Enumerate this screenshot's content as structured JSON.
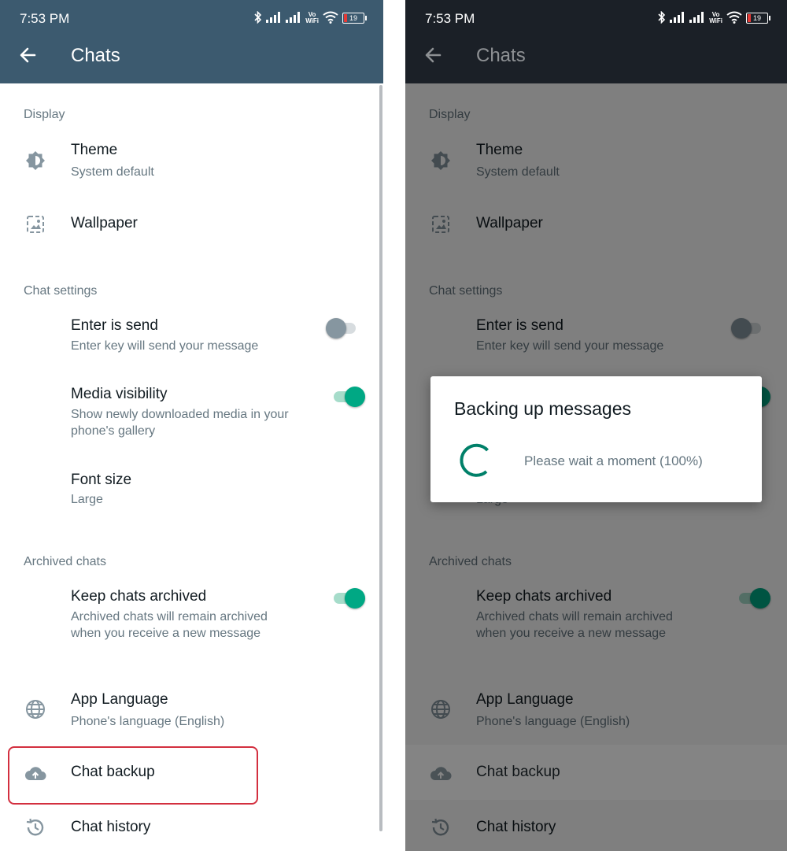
{
  "status_bar": {
    "time": "7:53 PM",
    "battery_level": "19",
    "vowifi_top": "Vo",
    "vowifi_bottom": "WiFi"
  },
  "appbar": {
    "title": "Chats"
  },
  "sections": {
    "display": "Display",
    "chat_settings": "Chat settings",
    "archived_chats": "Archived chats"
  },
  "items": {
    "theme": {
      "title": "Theme",
      "subtitle": "System default"
    },
    "wallpaper": {
      "title": "Wallpaper"
    },
    "enter_is_send": {
      "title": "Enter is send",
      "subtitle": "Enter key will send your message",
      "checked": false
    },
    "media_visibility": {
      "title": "Media visibility",
      "subtitle": "Show newly downloaded media in your phone's gallery",
      "checked": true
    },
    "font_size": {
      "title": "Font size",
      "subtitle": "Large"
    },
    "keep_chats_archived": {
      "title": "Keep chats archived",
      "subtitle": "Archived chats will remain archived when you receive a new message",
      "checked": true
    },
    "app_language": {
      "title": "App Language",
      "subtitle": "Phone's language (English)"
    },
    "chat_backup": {
      "title": "Chat backup"
    },
    "chat_history": {
      "title": "Chat history"
    }
  },
  "dialog": {
    "title": "Backing up messages",
    "message": "Please wait a moment (100%)",
    "progress": 100
  },
  "colors": {
    "accent": "#00a884",
    "appbar_light": "#3c5a6f",
    "appbar_dark": "#1b2027",
    "highlight": "#d32f3f"
  }
}
